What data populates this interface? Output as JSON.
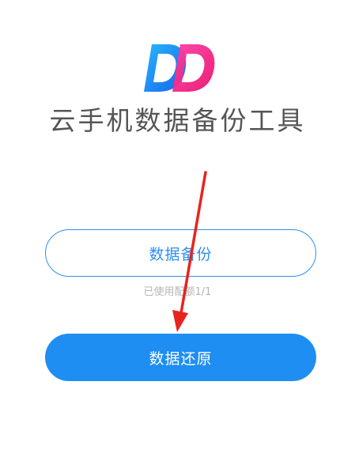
{
  "app": {
    "title": "云手机数据备份工具"
  },
  "actions": {
    "backup_label": "数据备份",
    "quota_text": "已使用配额1/1",
    "restore_label": "数据还原"
  },
  "colors": {
    "logo_blue": "#1e90ff",
    "logo_pink": "#ff2d8a",
    "accent": "#1e8ef2",
    "arrow": "#e8231e"
  },
  "icons": {
    "logo": "dd-logo-icon",
    "annotation": "red-arrow-icon"
  }
}
